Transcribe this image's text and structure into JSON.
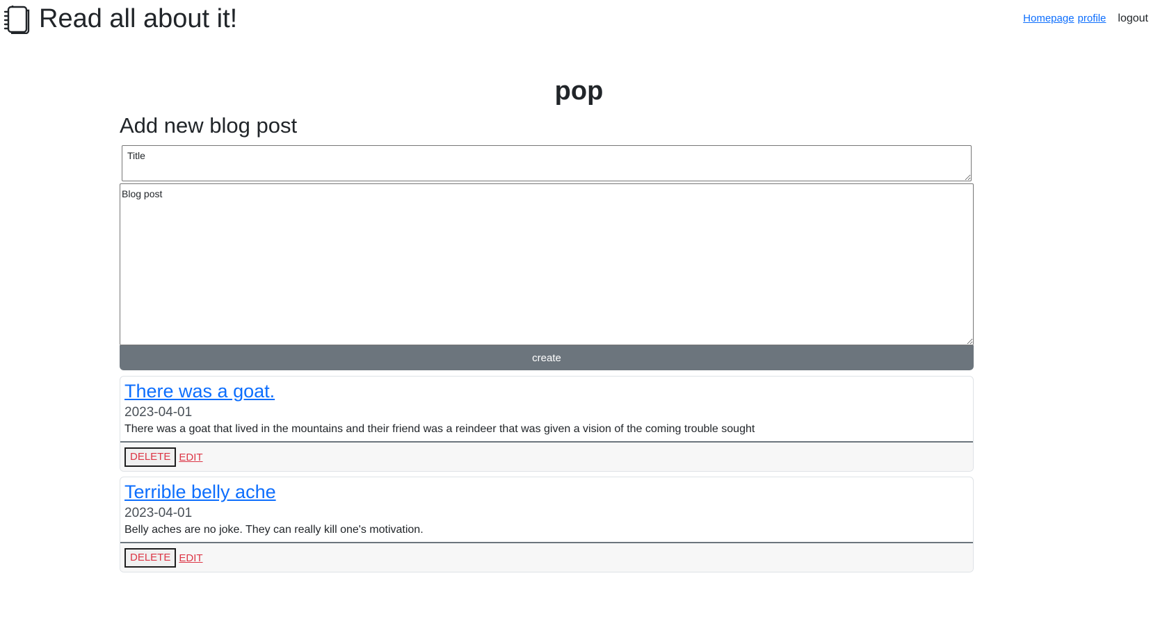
{
  "header": {
    "brand_icon": "notebook-icon",
    "brand_title": "Read all about it!",
    "nav": {
      "homepage_label": "Homepage",
      "profile_label": "profile",
      "logout_label": "logout"
    }
  },
  "main": {
    "username": "pop",
    "form": {
      "heading": "Add new blog post",
      "title_placeholder": "Title",
      "title_value": "",
      "body_placeholder": "Blog post",
      "body_value": "",
      "submit_label": "create"
    },
    "posts": [
      {
        "title": "There was a goat.",
        "date": "2023-04-01",
        "body": "There was a goat that lived in the mountains and their friend was a reindeer that was given a vision of the coming trouble sought",
        "delete_label": "DELETE",
        "edit_label": "EDIT"
      },
      {
        "title": "Terrible belly ache",
        "date": "2023-04-01",
        "body": "Belly aches are no joke. They can really kill one's motivation.",
        "delete_label": "DELETE",
        "edit_label": "EDIT"
      }
    ]
  },
  "colors": {
    "link": "#0d6efd",
    "danger": "#dc3545",
    "secondary_button": "#6c757d",
    "text": "#212529"
  }
}
